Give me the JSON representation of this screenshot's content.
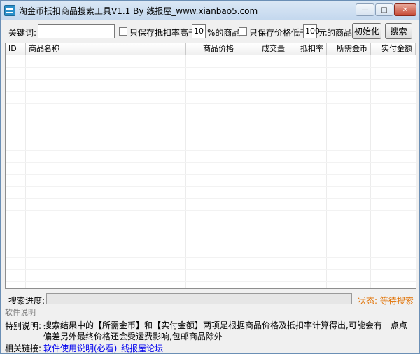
{
  "window": {
    "title": "淘金币抵扣商品搜索工具V1.1 By 线报屋_www.xianbao5.com",
    "min_glyph": "—",
    "max_glyph": "□",
    "close_glyph": "✕"
  },
  "toolbar": {
    "keyword_label": "关键词:",
    "keyword_value": "",
    "cb1_label": "只保存抵扣率高于",
    "cb1_value": "10",
    "cb1_suffix": "%的商品",
    "cb2_label": "只保存价格低于",
    "cb2_value": "100",
    "cb2_suffix": "元的商品",
    "init_button": "初始化",
    "search_button": "搜索"
  },
  "table": {
    "columns": [
      "ID",
      "商品名称",
      "商品价格",
      "成交量",
      "抵扣率",
      "所需金币",
      "实付金额"
    ],
    "rows": []
  },
  "progress": {
    "label": "搜索进度:",
    "value": 0,
    "status": "状态: 等待搜索"
  },
  "info": {
    "group_title": "软件说明",
    "desc_label": "特别说明:",
    "desc_text": "搜索结果中的【所需金币】和【实付金额】两项是根据商品价格及抵扣率计算得出,可能会有一点点偏差另外最终价格还会受运费影响,包邮商品除外",
    "links_label": "相关链接:",
    "link1": "软件使用说明(必看)",
    "link2": "线报屋论坛"
  },
  "colors": {
    "status": "#e07000",
    "link": "#0000ee"
  }
}
